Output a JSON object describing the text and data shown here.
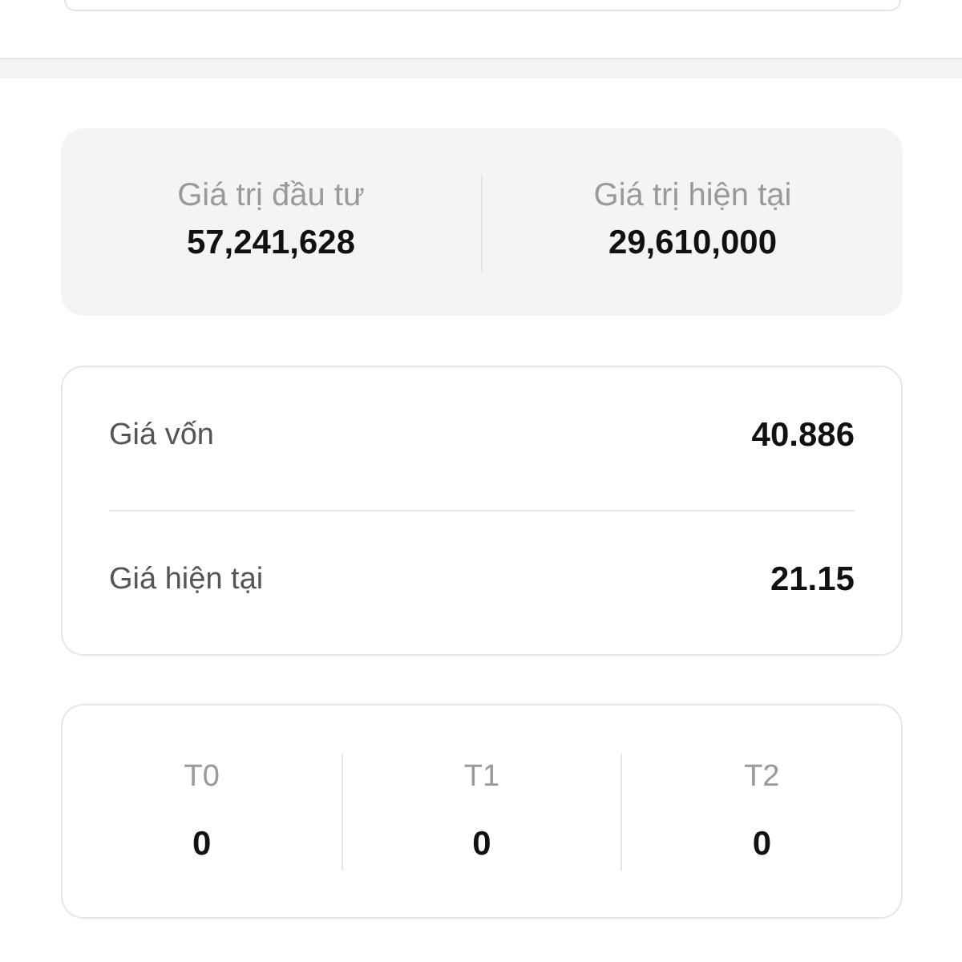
{
  "summary": [
    {
      "label": "Giá trị đầu tư",
      "value": "57,241,628"
    },
    {
      "label": "Giá trị hiện tại",
      "value": "29,610,000"
    }
  ],
  "prices": [
    {
      "label": "Giá vốn",
      "value": "40.886"
    },
    {
      "label": "Giá hiện tại",
      "value": "21.15"
    }
  ],
  "settlement": [
    {
      "label": "T0",
      "value": "0"
    },
    {
      "label": "T1",
      "value": "0"
    },
    {
      "label": "T2",
      "value": "0"
    }
  ]
}
